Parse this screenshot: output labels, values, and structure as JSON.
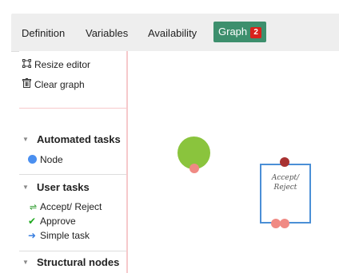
{
  "tabs": {
    "definition": "Definition",
    "variables": "Variables",
    "availability": "Availability",
    "graph": "Graph",
    "graph_badge": "2"
  },
  "editor_actions": {
    "resize": "Resize editor",
    "clear": "Clear graph"
  },
  "palette": {
    "automated": {
      "title": "Automated tasks",
      "items": [
        "Node"
      ]
    },
    "user": {
      "title": "User tasks",
      "items": [
        "Accept/ Reject",
        "Approve",
        "Simple task"
      ]
    },
    "structural": {
      "title": "Structural nodes"
    }
  },
  "canvas": {
    "task_label_line1": "Accept/",
    "task_label_line2": "Reject"
  },
  "colors": {
    "active_tab": "#3d8f6d",
    "badge": "#d9221c",
    "start_node": "#8ac43d",
    "out_port": "#f08a84",
    "in_port": "#a83232",
    "task_border": "#4b8fd6",
    "node_dot": "#4a8ff0"
  },
  "icons": {
    "resize": "resize-icon",
    "clear": "trash-icon",
    "node": "circle-icon",
    "accept_reject": "swap-arrows-icon",
    "approve": "checkmark-icon",
    "simple": "arrow-right-icon",
    "section_caret": "caret-down-icon"
  }
}
